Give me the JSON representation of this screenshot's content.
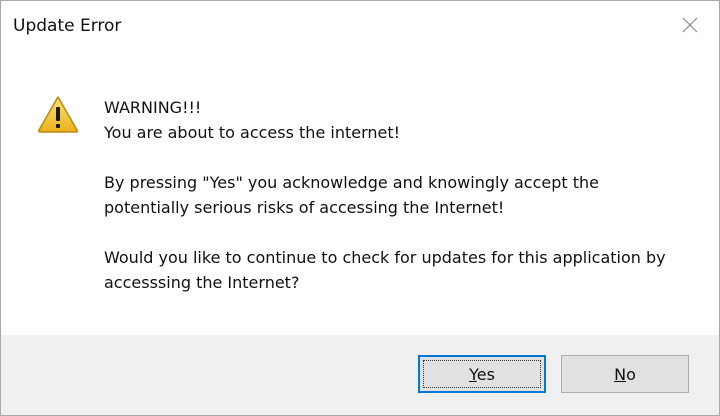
{
  "window": {
    "title": "Update Error"
  },
  "icons": {
    "close": "close-icon",
    "warning": "warning-triangle-icon"
  },
  "message": {
    "heading": "WARNING!!!",
    "line1": "You are about to access the internet!",
    "paragraph2": "By pressing \"Yes\" you acknowledge and knowingly accept the\npotentially serious risks of accessing the Internet!",
    "paragraph3": "Would you like to continue to check for updates for this application by\naccesssing the Internet?"
  },
  "buttons": {
    "yes": {
      "mnemonic": "Y",
      "rest": "es"
    },
    "no": {
      "mnemonic": "N",
      "rest": "o"
    }
  },
  "colors": {
    "warning_fill": "#f4c430",
    "accent": "#0078d7",
    "footer_bg": "#f0f0f0"
  }
}
